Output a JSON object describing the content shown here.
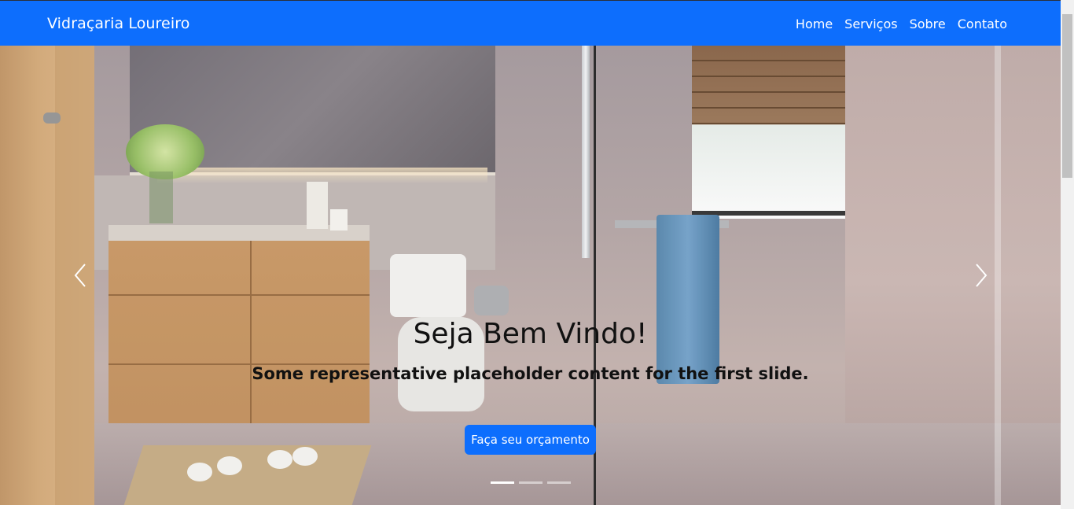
{
  "navbar": {
    "brand": "Vidraçaria Loureiro",
    "links": [
      {
        "label": "Home"
      },
      {
        "label": "Serviços"
      },
      {
        "label": "Sobre"
      },
      {
        "label": "Contato"
      }
    ],
    "background_color": "#0d6efd"
  },
  "carousel": {
    "slide_image": "bathroom-with-glass-shower",
    "caption_title": "Seja Bem Vindo!",
    "caption_text": "Some representative placeholder content for the first slide.",
    "cta_label": "Faça seu orçamento",
    "prev_icon": "chevron-left-icon",
    "next_icon": "chevron-right-icon",
    "indicators": [
      {
        "slide": 1,
        "active": true
      },
      {
        "slide": 2,
        "active": false
      },
      {
        "slide": 3,
        "active": false
      }
    ]
  },
  "colors": {
    "accent": "#0d6efd",
    "caption_text": "#111111"
  }
}
